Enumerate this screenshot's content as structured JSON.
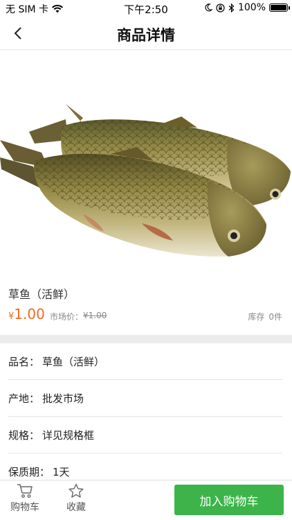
{
  "status_bar": {
    "carrier": "无 SIM 卡",
    "time": "下午2:50",
    "battery": "100%"
  },
  "nav": {
    "title": "商品详情"
  },
  "product": {
    "name": "草鱼（活鲜）",
    "currency_symbol": "¥",
    "price": "1.00",
    "market_label": "市场价：",
    "market_price": "¥1.00",
    "stock_label": "库存",
    "stock_value": "0件"
  },
  "attributes": [
    {
      "label": "品名：",
      "value": "草鱼（活鲜）"
    },
    {
      "label": "产地：",
      "value": "批发市场"
    },
    {
      "label": "规格：",
      "value": "详见规格框"
    },
    {
      "label": "保质期：",
      "value": "1天"
    }
  ],
  "bottom_bar": {
    "cart_label": "购物车",
    "favorite_label": "收藏",
    "add_to_cart_label": "加入购物车"
  },
  "colors": {
    "price": "#f06a1e",
    "add_to_cart": "#3cb44a"
  }
}
